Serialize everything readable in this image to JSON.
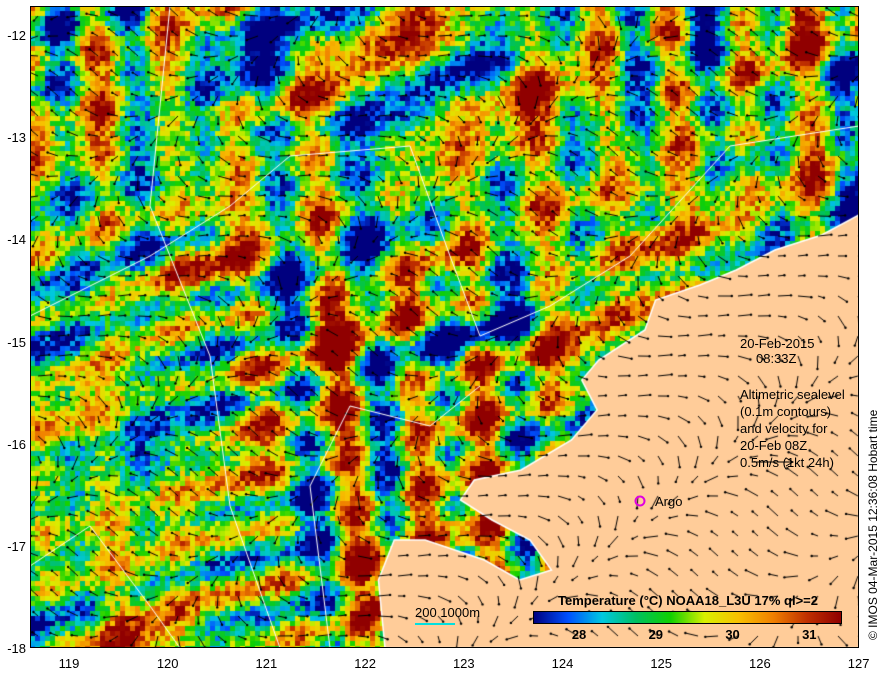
{
  "y_ticks": [
    "-12",
    "-13",
    "-14",
    "-15",
    "-16",
    "-17",
    "-18"
  ],
  "x_ticks": [
    "119",
    "120",
    "121",
    "122",
    "123",
    "124",
    "125",
    "126",
    "127"
  ],
  "date": "20-Feb-2015",
  "time": "08:33Z",
  "legend_lines": [
    "Altimetric sealevel",
    "(0.1m contours)",
    "and velocity for",
    "20-Feb 08Z",
    "0.5m/s (1kt 24h)"
  ],
  "argo_label": "Argo",
  "scale_label": "200  1000m",
  "colorbar": {
    "title": "Temperature (°C) NOAA18_L3U 17% ql>=2",
    "ticks": [
      "28",
      "29",
      "30",
      "31"
    ],
    "range": [
      27.4,
      31.4
    ],
    "colors": [
      "#00007f",
      "#0050ff",
      "#00c8e0",
      "#00c060",
      "#10d000",
      "#d8f000",
      "#f8c000",
      "#f08000",
      "#c03000",
      "#900000"
    ]
  },
  "credit": "© IMOS 04-Mar-2015 12:36:08 Hobart time",
  "land_color": "#ffcc99"
}
